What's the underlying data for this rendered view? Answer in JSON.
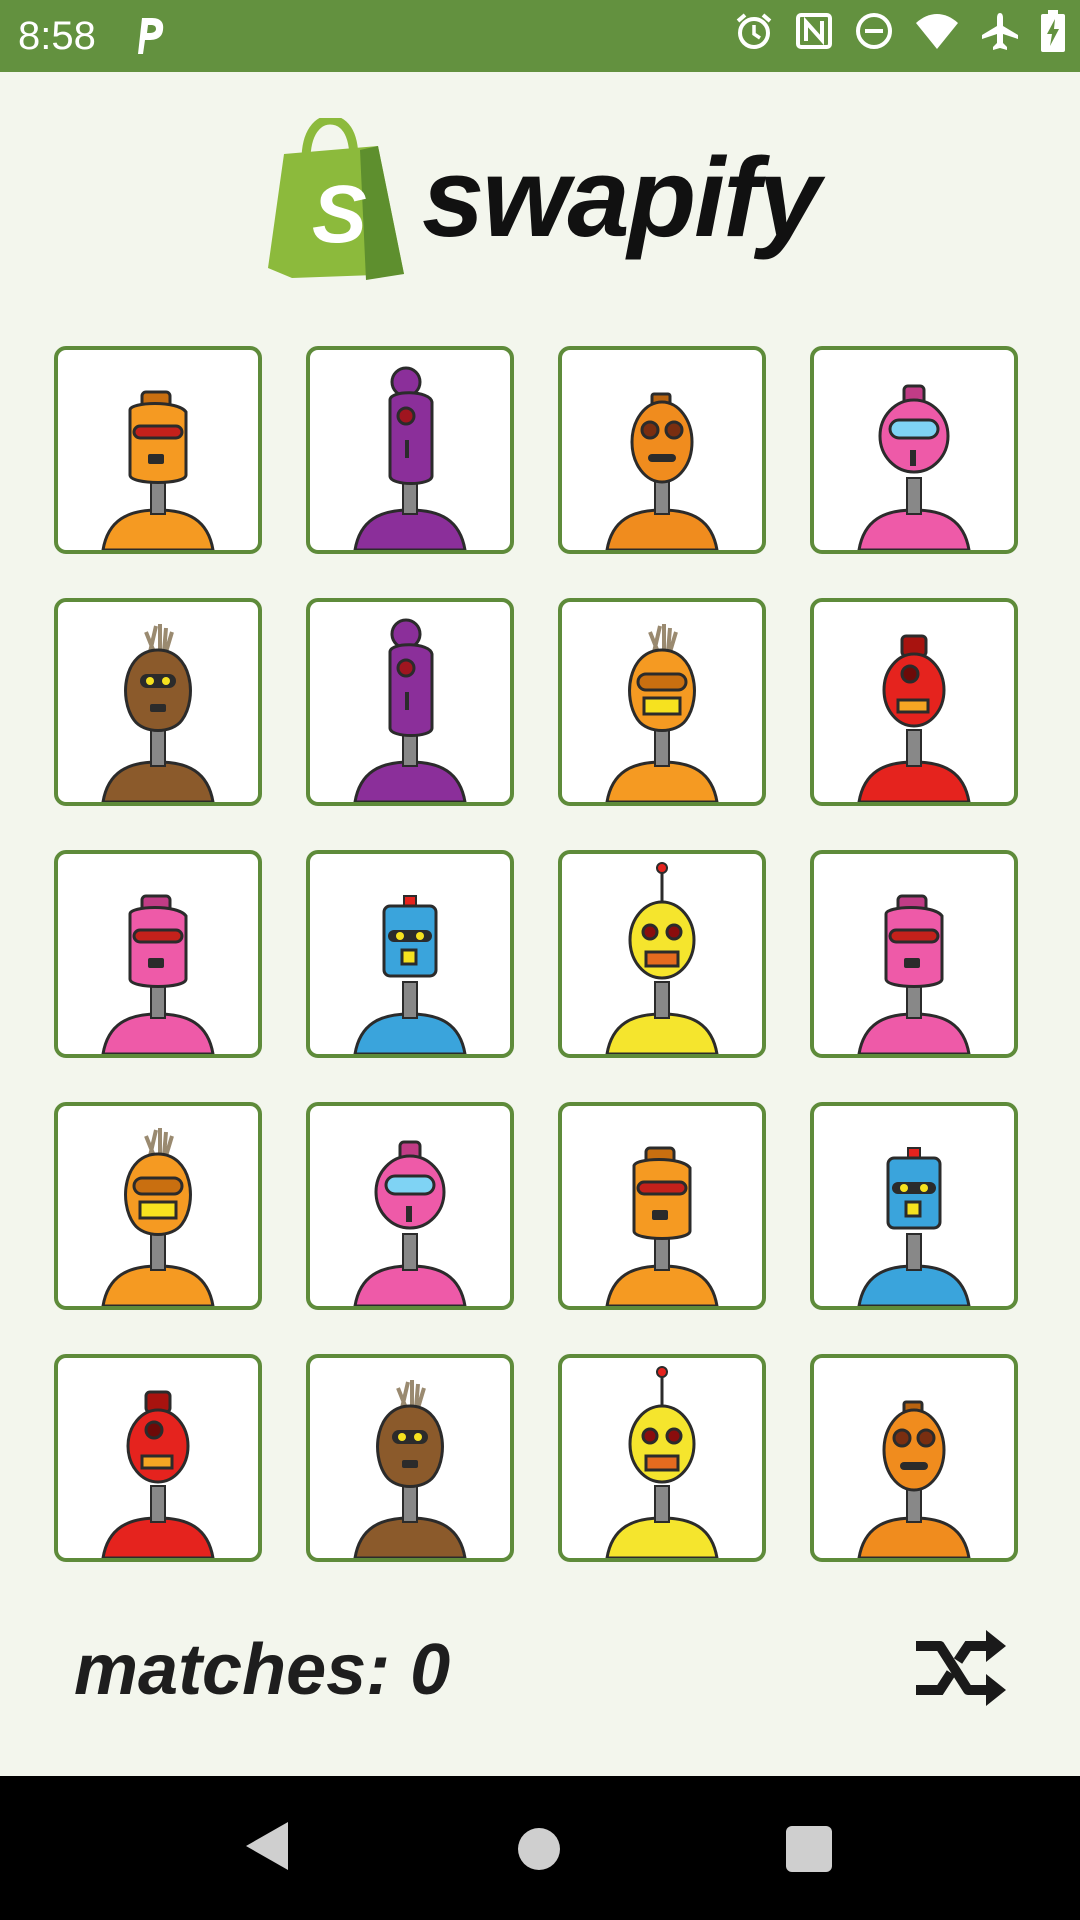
{
  "status_bar": {
    "time": "8:58",
    "icons": [
      "parking-icon",
      "alarm-icon",
      "nfc-icon",
      "do-not-disturb-icon",
      "wifi-icon",
      "airplane-icon",
      "battery-charging-icon"
    ],
    "background": "#63913f"
  },
  "header": {
    "logo_icon": "shopify-bag-icon",
    "logo_letter": "S",
    "app_name": "swapify"
  },
  "board": {
    "columns": 4,
    "rows": 5,
    "tiles": [
      {
        "robot": "orange-visor"
      },
      {
        "robot": "purple-cyclops"
      },
      {
        "robot": "orange-round"
      },
      {
        "robot": "pink-goggles"
      },
      {
        "robot": "brown-tuft"
      },
      {
        "robot": "purple-cyclops"
      },
      {
        "robot": "orange-tuft"
      },
      {
        "robot": "red-cyclops"
      },
      {
        "robot": "pink-visor"
      },
      {
        "robot": "blue-can"
      },
      {
        "robot": "yellow-antenna"
      },
      {
        "robot": "pink-visor"
      },
      {
        "robot": "orange-tuft"
      },
      {
        "robot": "pink-goggles"
      },
      {
        "robot": "orange-visor"
      },
      {
        "robot": "blue-can"
      },
      {
        "robot": "red-cyclops"
      },
      {
        "robot": "brown-tuft"
      },
      {
        "robot": "yellow-antenna"
      },
      {
        "robot": "orange-round"
      }
    ],
    "tile_border_color": "#5e8b3a"
  },
  "score": {
    "label": "matches: 0",
    "value": 0
  },
  "shuffle": {
    "icon": "shuffle-icon"
  },
  "nav_bar": {
    "icons": [
      "back-icon",
      "home-icon",
      "recents-icon"
    ]
  },
  "colors": {
    "accent_green": "#63913f",
    "background": "#f3f6ed",
    "bag_green": "#8cba3c"
  }
}
